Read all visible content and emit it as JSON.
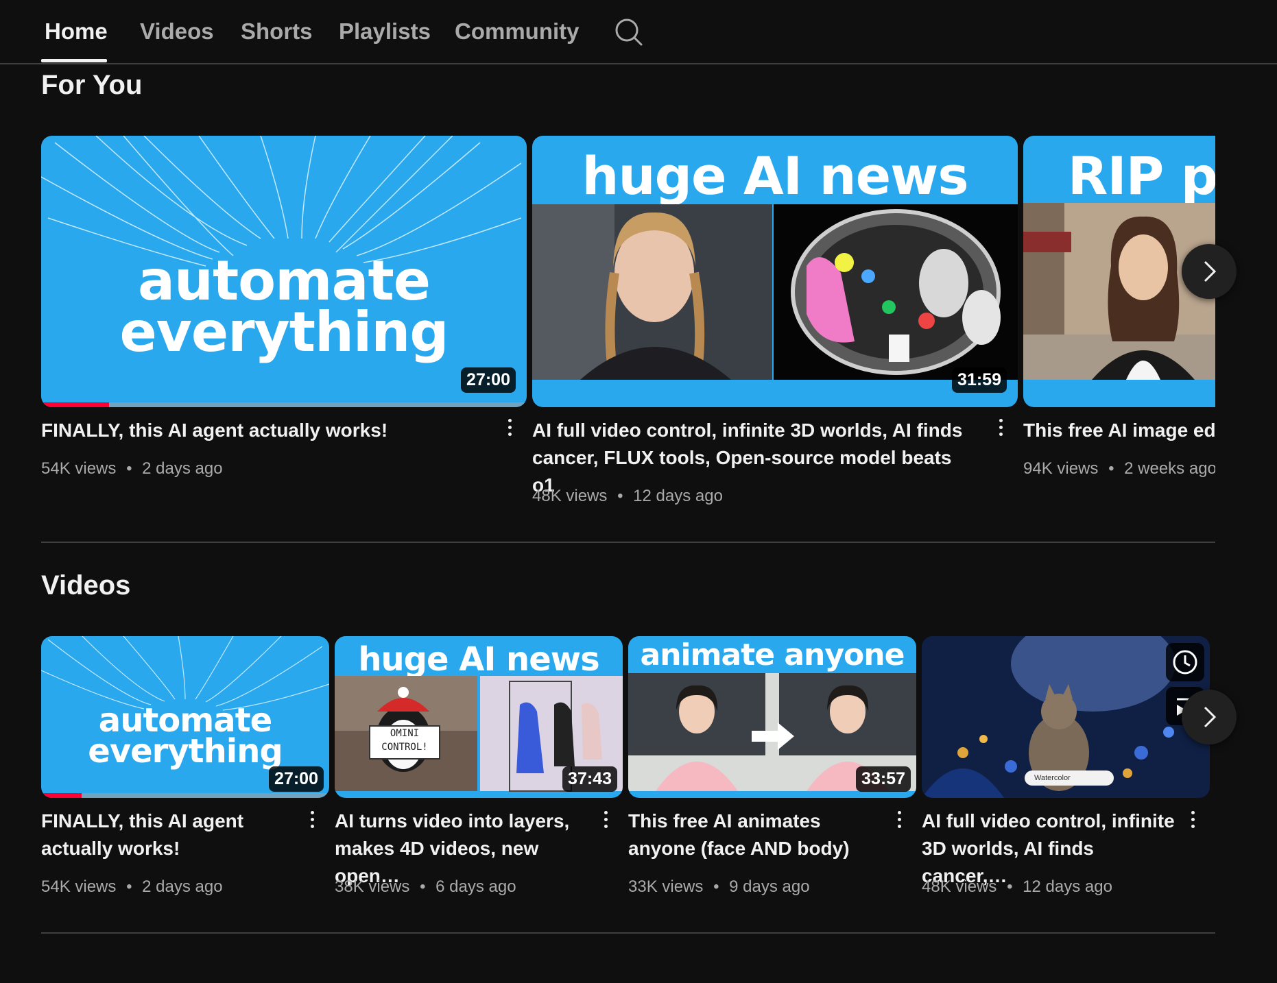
{
  "tabs": [
    {
      "label": "Home",
      "active": true
    },
    {
      "label": "Videos",
      "active": false
    },
    {
      "label": "Shorts",
      "active": false
    },
    {
      "label": "Playlists",
      "active": false
    },
    {
      "label": "Community",
      "active": false
    }
  ],
  "icons": {
    "search": "search-icon",
    "more": "kebab-icon",
    "next": "chevron-right-icon",
    "watch_later": "clock-icon",
    "add_to_queue": "queue-icon"
  },
  "colors": {
    "background": "#0f0f0f",
    "thumb_blue": "#29a8ee",
    "progress": "#ff0033",
    "meta_text": "#aaaaaa"
  },
  "for_you": {
    "heading": "For You",
    "videos": [
      {
        "thumb_text_1": "automate",
        "thumb_text_2": "everything",
        "duration": "27:00",
        "title": "FINALLY, this AI agent actually works!",
        "views": "54K views",
        "age": "2 days ago",
        "watched_fraction": 0.14
      },
      {
        "thumb_text_1": "huge AI news",
        "duration": "31:59",
        "title": "AI full video control, infinite 3D worlds, AI finds cancer, FLUX tools, Open-source model beats o1",
        "views": "48K views",
        "age": "12 days ago"
      },
      {
        "thumb_text_1": "RIP p",
        "title": "This free AI image edit",
        "views": "94K views",
        "age": "2 weeks ago"
      }
    ]
  },
  "videos": {
    "heading": "Videos",
    "videos": [
      {
        "thumb_text_1": "automate",
        "thumb_text_2": "everything",
        "duration": "27:00",
        "title": "FINALLY, this AI agent actually works!",
        "views": "54K views",
        "age": "2 days ago",
        "watched_fraction": 0.14
      },
      {
        "thumb_text_1": "huge AI news",
        "sign_text": "OMINI CONTROL!",
        "duration": "37:43",
        "title": "AI turns video into layers, makes 4D videos, new open…",
        "views": "38K views",
        "age": "6 days ago"
      },
      {
        "thumb_text_1": "animate anyone",
        "duration": "33:57",
        "title": "This free AI animates anyone (face AND body)",
        "views": "33K views",
        "age": "9 days ago"
      },
      {
        "toggle_label": "Watercolor",
        "title": "AI full video control, infinite 3D worlds, AI finds cancer,…",
        "views": "48K views",
        "age": "12 days ago"
      }
    ]
  },
  "separator": "•"
}
